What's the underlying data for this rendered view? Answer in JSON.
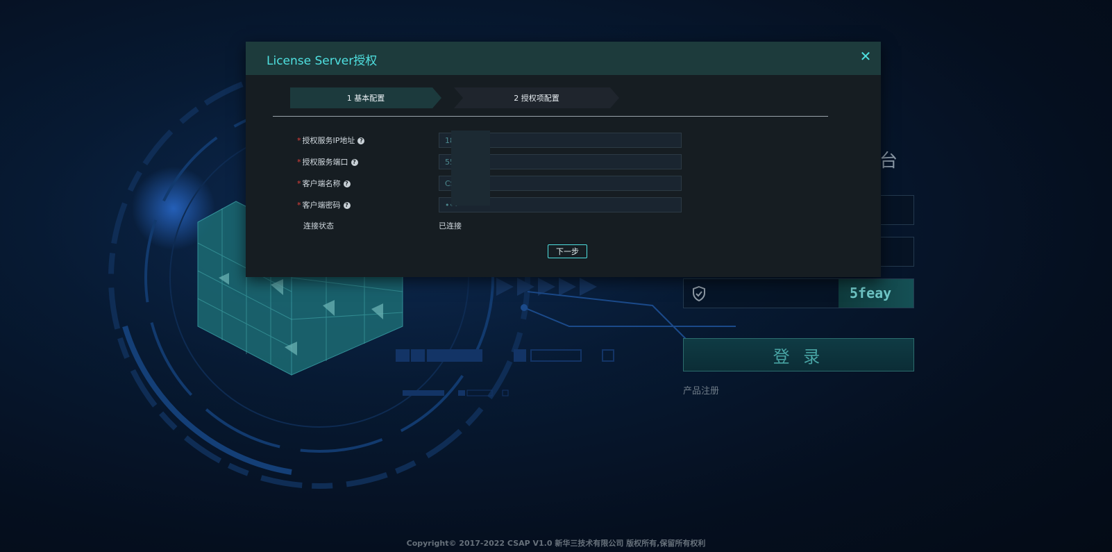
{
  "modal": {
    "title": "License Server授权",
    "close_icon": "close-icon",
    "steps": [
      {
        "label": "1 基本配置",
        "active": true
      },
      {
        "label": "2 授权项配置",
        "active": false
      }
    ],
    "fields": [
      {
        "label": "授权服务IP地址",
        "value": "18          1",
        "required": true
      },
      {
        "label": "授权服务端口",
        "value": "55",
        "required": true
      },
      {
        "label": "客户端名称",
        "value": "CS",
        "required": true
      },
      {
        "label": "客户端密码",
        "value": "•••",
        "required": true
      }
    ],
    "status": {
      "label": "连接状态",
      "value": "已连接"
    },
    "next_label": "下一步"
  },
  "login": {
    "title_tail": "台",
    "captcha_text": "5feay",
    "login_label": "登 录",
    "register_label": "产品注册"
  },
  "footer": {
    "copyright": "Copyright© 2017-2022 CSAP V1.0 新华三技术有限公司 版权所有,保留所有权利"
  },
  "colors": {
    "accent": "#4fe0e0",
    "required": "#e0413a",
    "modal_bg": "#161d22",
    "header_bg": "#1d3b3c"
  }
}
